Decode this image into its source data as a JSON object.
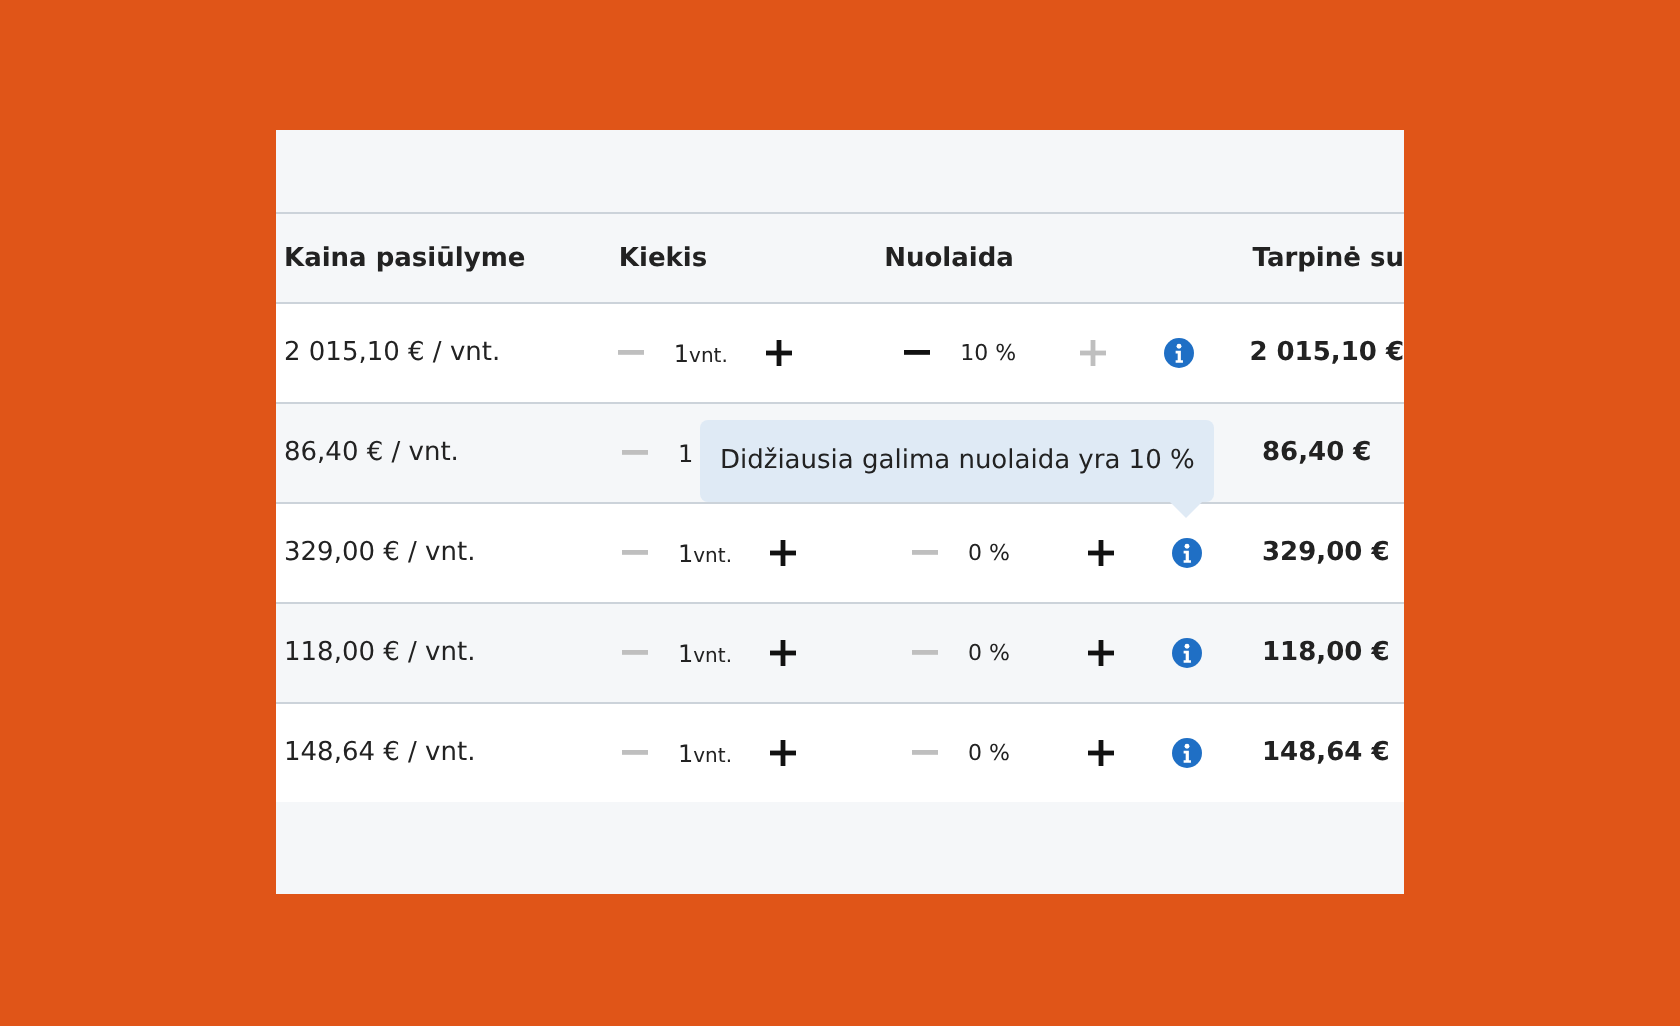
{
  "table": {
    "columns": [
      "Kaina pasiūlyme",
      "Kiekis",
      "Nuolaida",
      "Tarpinė su"
    ],
    "rows": [
      {
        "price": "2 015,10 € / vnt.",
        "qty": "1",
        "qty_unit": "vnt.",
        "qty_minus_enabled": false,
        "qty_plus_enabled": true,
        "discount": "10 %",
        "disc_minus_enabled": true,
        "disc_plus_enabled": false,
        "subtotal": "2 015,10 €"
      },
      {
        "price": "86,40 € / vnt.",
        "qty": "1",
        "qty_minus_enabled": false,
        "subtotal": "86,40 €"
      },
      {
        "price": "329,00 € / vnt.",
        "qty": "1",
        "qty_unit": "vnt.",
        "qty_minus_enabled": false,
        "qty_plus_enabled": true,
        "discount": "0 %",
        "disc_minus_enabled": false,
        "disc_plus_enabled": true,
        "subtotal": "329,00 €"
      },
      {
        "price": "118,00 € / vnt.",
        "qty": "1",
        "qty_unit": "vnt.",
        "qty_minus_enabled": false,
        "qty_plus_enabled": true,
        "discount": "0 %",
        "disc_minus_enabled": false,
        "disc_plus_enabled": true,
        "subtotal": "118,00 €"
      },
      {
        "price": "148,64 € / vnt.",
        "qty": "1",
        "qty_unit": "vnt.",
        "qty_minus_enabled": false,
        "qty_plus_enabled": true,
        "discount": "0 %",
        "disc_minus_enabled": false,
        "disc_plus_enabled": true,
        "subtotal": "148,64 €"
      }
    ]
  },
  "tooltip": {
    "text": "Didžiausia galima nuolaida yra 10 %"
  }
}
